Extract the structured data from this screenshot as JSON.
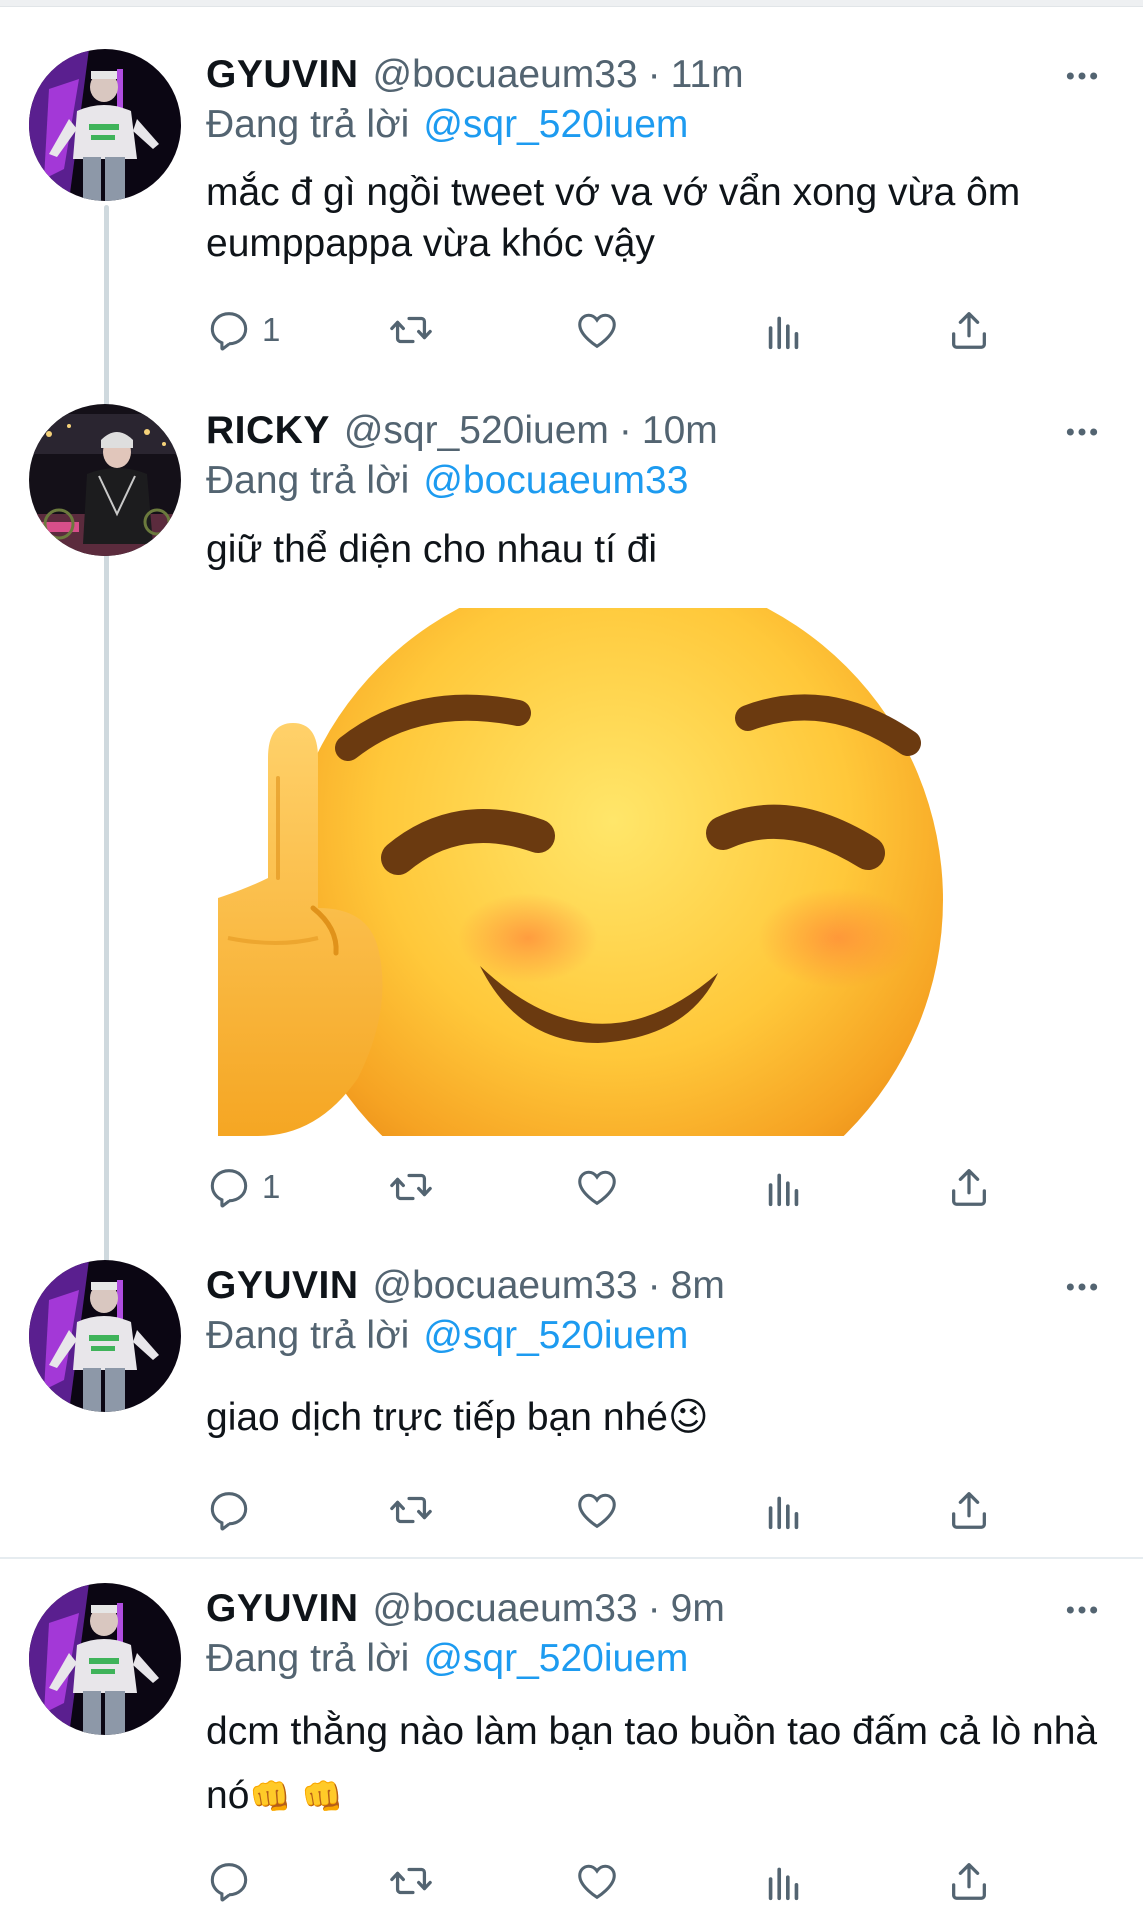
{
  "tweets": [
    {
      "name": "GYUVIN",
      "handle": "@bocuaeum33",
      "separator": "·",
      "time": "11m",
      "replying_label": "Đang trả lời",
      "replying_to": "@sqr_520iuem",
      "text": "mắc đ gì ngồi tweet vớ va vớ vẩn xong vừa ôm eumppappa vừa khóc vậy",
      "reply_count": "1",
      "avatar": "avatar-gyuvin"
    },
    {
      "name": "RICKY",
      "handle": "@sqr_520iuem",
      "separator": "·",
      "time": "10m",
      "replying_label": "Đang trả lời",
      "replying_to": "@bocuaeum33",
      "text": "giữ thể diện cho nhau tí đi",
      "reply_count": "1",
      "media": "smiling-face-middle-finger-emoji",
      "avatar": "avatar-ricky"
    },
    {
      "name": "GYUVIN",
      "handle": "@bocuaeum33",
      "separator": "·",
      "time": "8m",
      "replying_label": "Đang trả lời",
      "replying_to": "@sqr_520iuem",
      "text": "giao dịch trực tiếp bạn nhé",
      "text_emoji": "😉",
      "reply_count": "",
      "avatar": "avatar-gyuvin"
    },
    {
      "name": "GYUVIN",
      "handle": "@bocuaeum33",
      "separator": "·",
      "time": "9m",
      "replying_label": "Đang trả lời",
      "replying_to": "@sqr_520iuem",
      "text": "dcm thằng nào làm bạn tao buồn tao đấm cả lò nhà nó",
      "text_emoji": "👊 👊",
      "reply_count": "",
      "avatar": "avatar-gyuvin"
    }
  ],
  "icons": {
    "reply": "reply-icon",
    "retweet": "retweet-icon",
    "like": "heart-icon",
    "views": "views-icon",
    "share": "share-icon",
    "more": "more-icon"
  },
  "colors": {
    "name": "#0f1419",
    "secondary": "#536471",
    "mention": "#1d9bf0",
    "thread_line": "#cfd9de"
  }
}
